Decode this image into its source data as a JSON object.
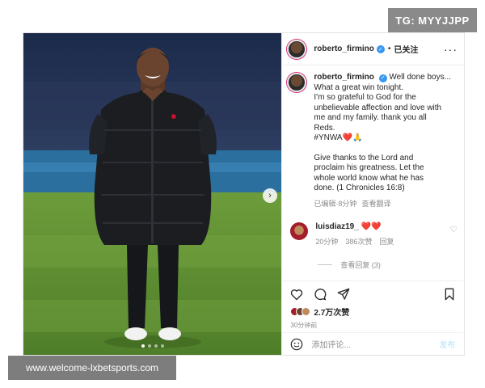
{
  "badge": "TG: MYYJJPP",
  "watermark": "www.welcome-lxbetsports.com",
  "header": {
    "username": "roberto_firmino",
    "separator": "•",
    "follow_label": "已关注",
    "more_label": "···"
  },
  "caption": {
    "username": "roberto_firmino",
    "lines": [
      "Well done boys...",
      "What a great win tonight.",
      "I'm so grateful to God for the",
      "unbelievable affection and love with",
      "me and my family. thank you all",
      "Reds.",
      "#YNWA❤️🙏",
      "",
      "Give thanks to the Lord and",
      "proclaim his greatness. Let the",
      "whole world know what he has",
      "done. (1 Chronicles 16:8)"
    ],
    "edited": "已编辑",
    "dot": "·",
    "time": "8分钟",
    "translate": "查看翻译"
  },
  "comment": {
    "username": "luisdiaz19_",
    "hearts": "❤️❤️",
    "time": "20分钟",
    "likes": "386次赞",
    "reply": "回复",
    "view_replies": "查看回复 (3)"
  },
  "stats": {
    "likes": "2.7万次赞",
    "time_ago": "30分钟前"
  },
  "composer": {
    "placeholder": "添加评论...",
    "publish": "发布"
  },
  "colors": {
    "verified": "#3897f0",
    "heart": "#d81e2a",
    "publish_disabled": "#b2dffc"
  },
  "icons": [
    "heart-icon",
    "comment-icon",
    "share-icon",
    "bookmark-icon",
    "emoji-icon",
    "chevron-right-icon",
    "verified-icon"
  ]
}
